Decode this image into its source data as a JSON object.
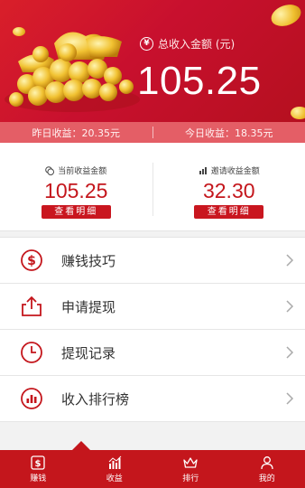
{
  "header": {
    "total_label": "总收入金额 (元)",
    "total_value": "105.25",
    "yesterday": "昨日收益：20.35元",
    "today": "今日收益：18.35元"
  },
  "earnings": {
    "current": {
      "label": "当前收益金额",
      "value": "105.25",
      "button": "查看明细"
    },
    "invite": {
      "label": "邀请收益金额",
      "value": "32.30",
      "button": "查看明细"
    }
  },
  "menu": [
    {
      "label": "赚钱技巧",
      "icon": "dollar-circle-icon"
    },
    {
      "label": "申请提现",
      "icon": "share-upload-icon"
    },
    {
      "label": "提现记录",
      "icon": "clock-icon"
    },
    {
      "label": "收入排行榜",
      "icon": "bar-chart-circle-icon"
    }
  ],
  "tabs": [
    {
      "label": "赚钱",
      "icon": "dollar-icon"
    },
    {
      "label": "收益",
      "icon": "bars-icon"
    },
    {
      "label": "排行",
      "icon": "crown-icon"
    },
    {
      "label": "我的",
      "icon": "person-icon"
    }
  ],
  "colors": {
    "primary_red": "#c4161c",
    "header_red": "#d91f2a",
    "sub_bar": "#e45e66"
  }
}
